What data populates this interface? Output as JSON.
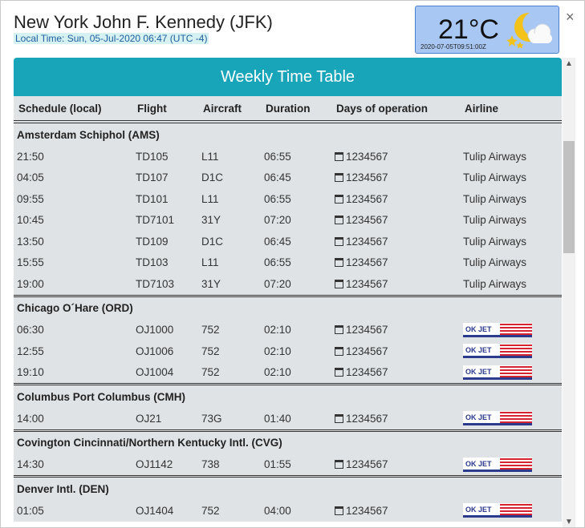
{
  "header": {
    "title": "New York John F. Kennedy (JFK)",
    "local_time": "Local Time: Sun, 05-Jul-2020 06:47 (UTC -4)"
  },
  "weather": {
    "temperature": "21°C",
    "timestamp": "2020-07-05T09:51:00Z",
    "icon": "moon-cloud-icon"
  },
  "close_label": "×",
  "banner": "Weekly Time Table",
  "columns": [
    "Schedule (local)",
    "Flight",
    "Aircraft",
    "Duration",
    "Days of operation",
    "Airline"
  ],
  "okjet_logo_text": "OK JET",
  "groups": [
    {
      "name": "Amsterdam Schiphol (AMS)",
      "rows": [
        {
          "time": "21:50",
          "flight": "TD105",
          "aircraft": "L11",
          "duration": "06:55",
          "days": "1234567",
          "airline": "Tulip Airways"
        },
        {
          "time": "04:05",
          "flight": "TD107",
          "aircraft": "D1C",
          "duration": "06:45",
          "days": "1234567",
          "airline": "Tulip Airways"
        },
        {
          "time": "09:55",
          "flight": "TD101",
          "aircraft": "L11",
          "duration": "06:55",
          "days": "1234567",
          "airline": "Tulip Airways"
        },
        {
          "time": "10:45",
          "flight": "TD7101",
          "aircraft": "31Y",
          "duration": "07:20",
          "days": "1234567",
          "airline": "Tulip Airways"
        },
        {
          "time": "13:50",
          "flight": "TD109",
          "aircraft": "D1C",
          "duration": "06:45",
          "days": "1234567",
          "airline": "Tulip Airways"
        },
        {
          "time": "15:55",
          "flight": "TD103",
          "aircraft": "L11",
          "duration": "06:55",
          "days": "1234567",
          "airline": "Tulip Airways"
        },
        {
          "time": "19:00",
          "flight": "TD7103",
          "aircraft": "31Y",
          "duration": "07:20",
          "days": "1234567",
          "airline": "Tulip Airways"
        }
      ]
    },
    {
      "name": "Chicago O´Hare (ORD)",
      "rows": [
        {
          "time": "06:30",
          "flight": "OJ1000",
          "aircraft": "752",
          "duration": "02:10",
          "days": "1234567",
          "airline": "okjet-logo"
        },
        {
          "time": "12:55",
          "flight": "OJ1006",
          "aircraft": "752",
          "duration": "02:10",
          "days": "1234567",
          "airline": "okjet-logo"
        },
        {
          "time": "19:10",
          "flight": "OJ1004",
          "aircraft": "752",
          "duration": "02:10",
          "days": "1234567",
          "airline": "okjet-logo"
        }
      ]
    },
    {
      "name": "Columbus Port Columbus (CMH)",
      "rows": [
        {
          "time": "14:00",
          "flight": "OJ21",
          "aircraft": "73G",
          "duration": "01:40",
          "days": "1234567",
          "airline": "okjet-logo"
        }
      ]
    },
    {
      "name": "Covington Cincinnati/Northern Kentucky Intl. (CVG)",
      "rows": [
        {
          "time": "14:30",
          "flight": "OJ1142",
          "aircraft": "738",
          "duration": "01:55",
          "days": "1234567",
          "airline": "okjet-logo"
        }
      ]
    },
    {
      "name": "Denver Intl. (DEN)",
      "rows": [
        {
          "time": "01:05",
          "flight": "OJ1404",
          "aircraft": "752",
          "duration": "04:00",
          "days": "1234567",
          "airline": "okjet-logo"
        }
      ]
    }
  ]
}
